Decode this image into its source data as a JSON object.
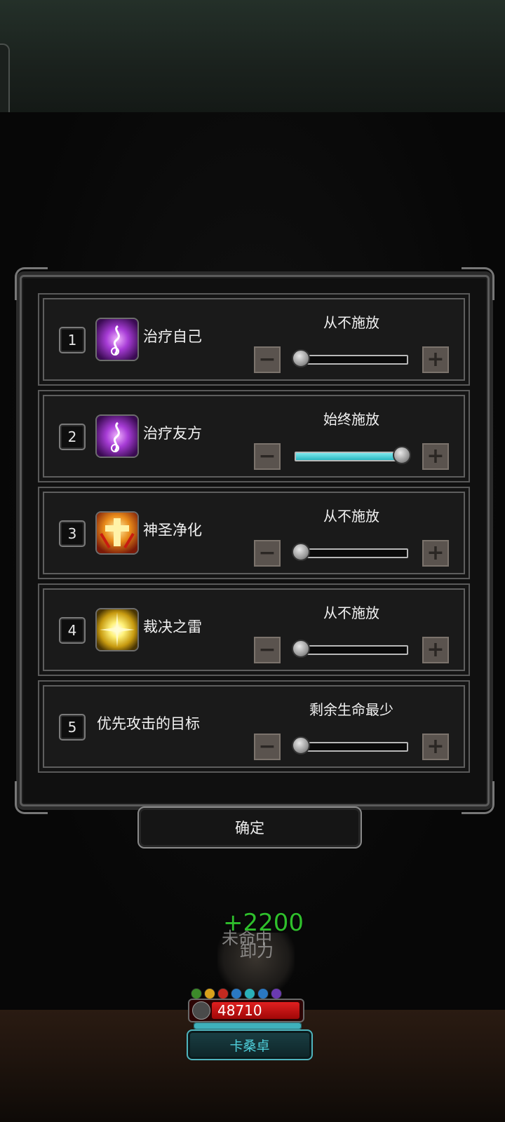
{
  "rows": [
    {
      "num": "1",
      "name": "治疗自己",
      "status": "从不施放",
      "icon": "purple-heal-icon",
      "level": 0
    },
    {
      "num": "2",
      "name": "治疗友方",
      "status": "始终施放",
      "icon": "purple-heal-icon",
      "level": 1
    },
    {
      "num": "3",
      "name": "神圣净化",
      "status": "从不施放",
      "icon": "holy-cross-icon",
      "level": 0
    },
    {
      "num": "4",
      "name": "裁决之雷",
      "status": "从不施放",
      "icon": "thunder-burst-icon",
      "level": 0
    },
    {
      "num": "5",
      "name": "优先攻击的目标",
      "status": "剩余生命最少",
      "icon": null,
      "level": 0
    }
  ],
  "controls": {
    "minus": "−",
    "plus": "+"
  },
  "confirm_label": "确定",
  "hud": {
    "heal_float": "+2200",
    "ghost_text_1": "未命中",
    "ghost_text_2": "卸力",
    "hp": "48710",
    "hp_fraction": 0.9,
    "mp_fraction": 1.0,
    "character_name": "卡桑卓"
  },
  "colors": {
    "slider_fill": "#2ab7c0",
    "hp_red": "#e02020",
    "heal_green": "#2fbf2c",
    "name_cyan": "#4fd0dc"
  }
}
